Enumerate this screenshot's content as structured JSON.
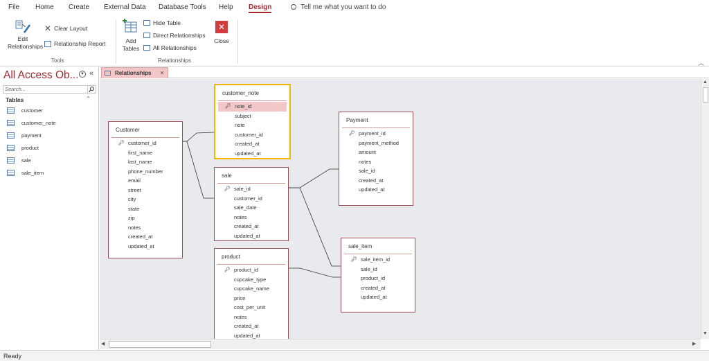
{
  "menu": {
    "file": "File",
    "home": "Home",
    "create": "Create",
    "external": "External Data",
    "dbtools": "Database Tools",
    "help": "Help",
    "design": "Design",
    "tellme": "Tell me what you want to do"
  },
  "ribbon": {
    "edit_relationships": "Edit Relationships",
    "clear_layout": "Clear Layout",
    "relationship_report": "Relationship Report",
    "tools_label": "Tools",
    "add_tables": "Add Tables",
    "hide_table": "Hide Table",
    "direct_relationships": "Direct Relationships",
    "all_relationships": "All Relationships",
    "close": "Close",
    "relationships_label": "Relationships"
  },
  "nav": {
    "title": "All Access Ob...",
    "search_placeholder": "Search...",
    "section": "Tables",
    "items": [
      "customer",
      "customer_note",
      "payment",
      "product",
      "sale",
      "sale_item"
    ]
  },
  "tab": {
    "label": "Relationships"
  },
  "tables": {
    "customer": {
      "title": "Customer",
      "fields": [
        "customer_id",
        "first_name",
        "last_name",
        "phone_number",
        "email",
        "street",
        "city",
        "state",
        "zip",
        "notes",
        "created_at",
        "updated_at"
      ]
    },
    "customer_note": {
      "title": "customer_note",
      "fields": [
        "note_id",
        "subject",
        "note",
        "customer_id",
        "created_at",
        "updated_at"
      ]
    },
    "sale": {
      "title": "sale",
      "fields": [
        "sale_id",
        "customer_id",
        "sale_date",
        "notes",
        "created_at",
        "updated_at"
      ]
    },
    "product": {
      "title": "product",
      "fields": [
        "product_id",
        "cupcake_type",
        "cupcake_name",
        "price",
        "cost_per_unit",
        "notes",
        "created_at",
        "updated_at"
      ]
    },
    "payment": {
      "title": "Payment",
      "fields": [
        "payment_id",
        "payment_method",
        "amount",
        "notes",
        "sale_id",
        "created_at",
        "updated_at"
      ]
    },
    "sale_item": {
      "title": "sale_item",
      "fields": [
        "sale_item_id",
        "sale_id",
        "product_id",
        "created_at",
        "updated_at"
      ]
    }
  },
  "status": {
    "text": "Ready"
  }
}
